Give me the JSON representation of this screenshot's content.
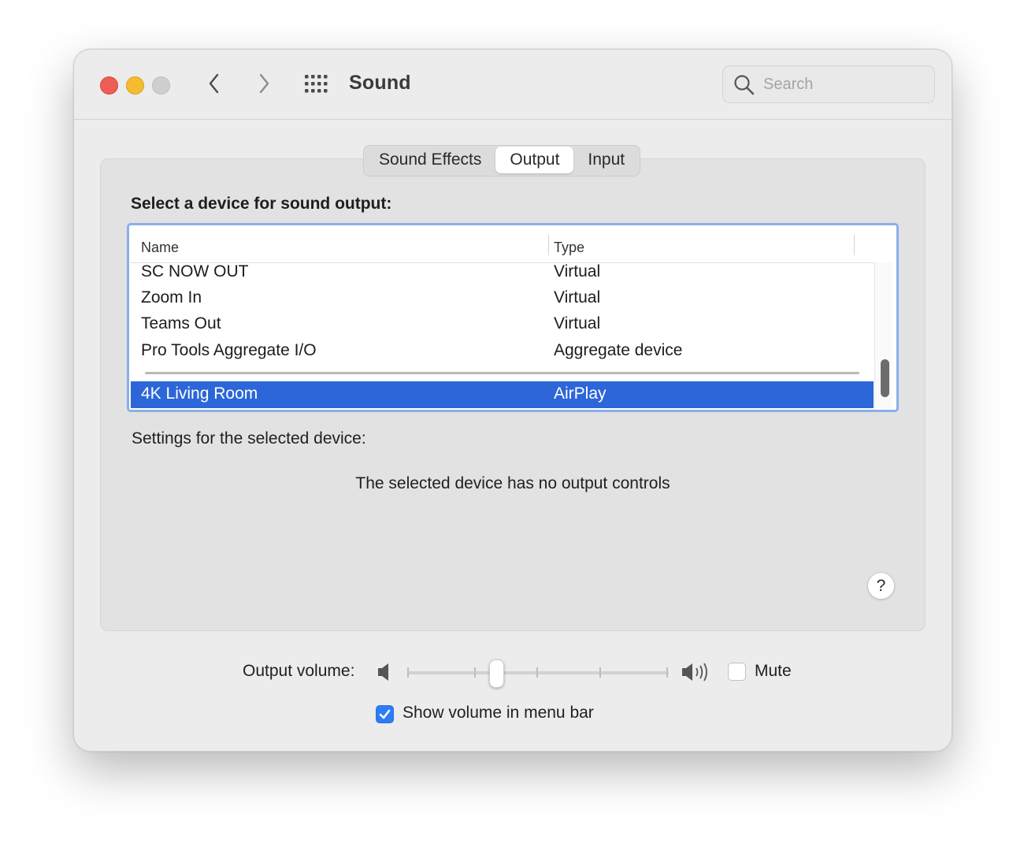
{
  "window": {
    "title": "Sound"
  },
  "search": {
    "placeholder": "Search"
  },
  "tabs": [
    {
      "label": "Sound Effects",
      "active": false
    },
    {
      "label": "Output",
      "active": true
    },
    {
      "label": "Input",
      "active": false
    }
  ],
  "output": {
    "prompt": "Select a device for sound output:",
    "columns": {
      "name": "Name",
      "type": "Type"
    },
    "devices": [
      {
        "name": "SC NOW OUT",
        "type": "Virtual"
      },
      {
        "name": "Zoom In",
        "type": "Virtual"
      },
      {
        "name": "Teams Out",
        "type": "Virtual"
      },
      {
        "name": "Pro Tools Aggregate I/O",
        "type": "Aggregate device"
      },
      {
        "name": "4K Living Room",
        "type": "AirPlay",
        "selected": true
      }
    ],
    "settings_label": "Settings for the selected device:",
    "no_controls_message": "The selected device has no output controls",
    "help_label": "?"
  },
  "volume": {
    "label": "Output volume:",
    "level": 0.33,
    "mute_label": "Mute",
    "mute_checked": false,
    "show_in_menu_bar_label": "Show volume in menu bar",
    "show_in_menu_bar_checked": true
  },
  "colors": {
    "selection": "#2c66d8",
    "focus_ring": "#8aaee9",
    "checkbox_on": "#2e7cf6",
    "close": "#ee5e57",
    "minimize": "#f4bd30"
  },
  "icons": [
    "close-button",
    "minimize-button",
    "zoom-button",
    "chevron-left-icon",
    "chevron-right-icon",
    "grid-icon",
    "search-icon",
    "speaker-low-icon",
    "speaker-high-icon",
    "checkmark-icon"
  ]
}
